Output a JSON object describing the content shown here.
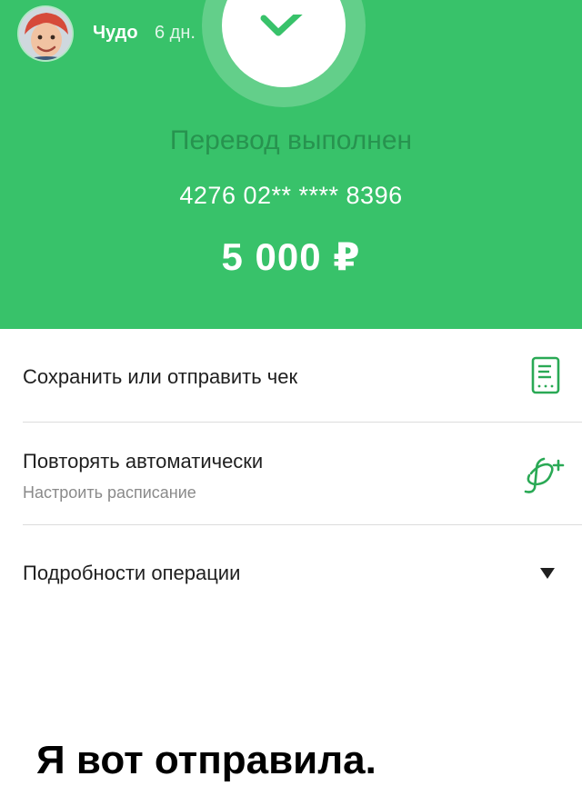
{
  "story": {
    "username": "Чудо",
    "time": "6 дн."
  },
  "transfer": {
    "status": "Перевод выполнен",
    "card_number": "4276 02** **** 8396",
    "amount": "5 000 ₽"
  },
  "actions": [
    {
      "title": "Сохранить или отправить чек",
      "icon": "receipt-icon"
    },
    {
      "title": "Повторять автоматически",
      "subtitle": "Настроить расписание",
      "icon": "autopay-icon"
    },
    {
      "title": "Подробности операции",
      "icon": "chevron-down-icon"
    }
  ],
  "caption": "Я вот отправила.",
  "colors": {
    "green": "#38c26a",
    "status_green": "#27934f",
    "icon_green": "#2aa955"
  }
}
